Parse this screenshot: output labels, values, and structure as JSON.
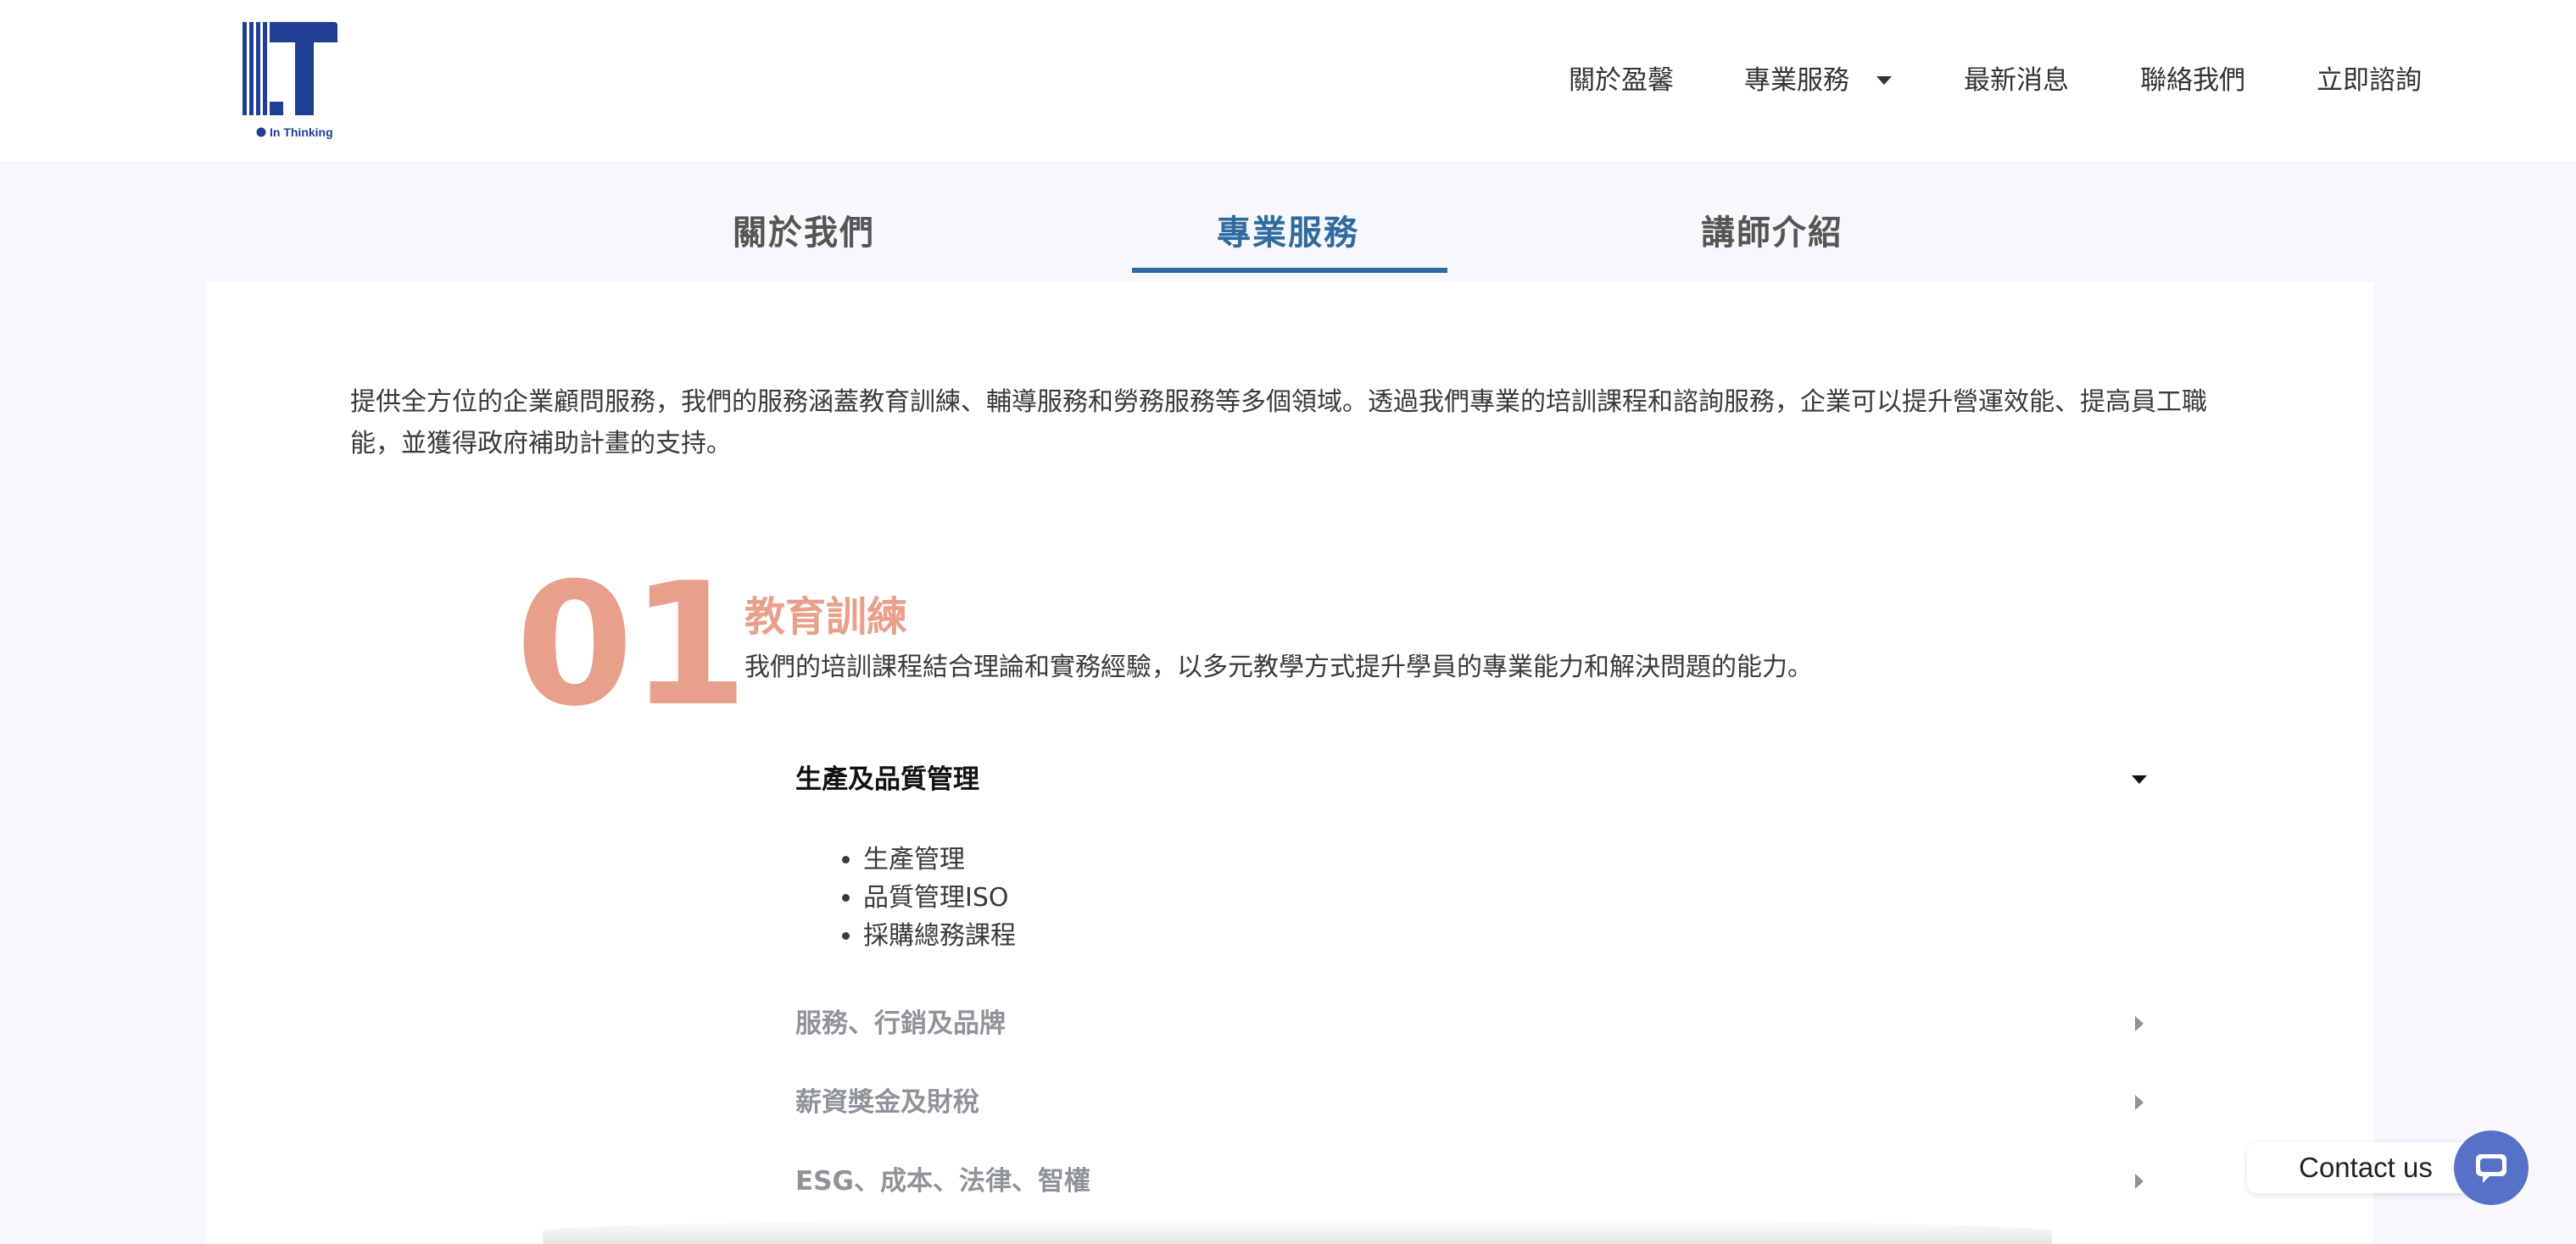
{
  "header": {
    "logo_text": "In Thinking",
    "nav": [
      {
        "label": "關於盈馨"
      },
      {
        "label": "專業服務",
        "has_dropdown": true
      },
      {
        "label": "最新消息"
      },
      {
        "label": "聯絡我們"
      },
      {
        "label": "立即諮詢"
      }
    ]
  },
  "tabs": [
    {
      "label": "關於我們",
      "active": false
    },
    {
      "label": "專業服務",
      "active": true
    },
    {
      "label": "講師介紹",
      "active": false
    }
  ],
  "intro": "提供全方位的企業顧問服務，我們的服務涵蓋教育訓練、輔導服務和勞務服務等多個領域。透過我們專業的培訓課程和諮詢服務，企業可以提升營運效能、提高員工職能，並獲得政府補助計畫的支持。",
  "section": {
    "number": "01",
    "title": "教育訓練",
    "description": "我們的培訓課程結合理論和實務經驗，以多元教學方式提升學員的專業能力和解決問題的能力。",
    "accordion": [
      {
        "label": "生產及品質管理",
        "expanded": true,
        "items": [
          "生產管理",
          "品質管理ISO",
          "採購總務課程"
        ]
      },
      {
        "label": "服務、行銷及品牌",
        "expanded": false
      },
      {
        "label": "薪資獎金及財稅",
        "expanded": false
      },
      {
        "label": "ESG、成本、法律、智權",
        "expanded": false
      }
    ]
  },
  "contact": {
    "label": "Contact us"
  },
  "colors": {
    "accent_blue": "#2f6b9f",
    "salmon": "#e8a08a",
    "logo_blue": "#1f3f94",
    "fab": "#5672c7"
  },
  "icons": {
    "dropdown": "caret-down-icon",
    "collapsed": "caret-right-icon",
    "chat": "chat-icon"
  }
}
